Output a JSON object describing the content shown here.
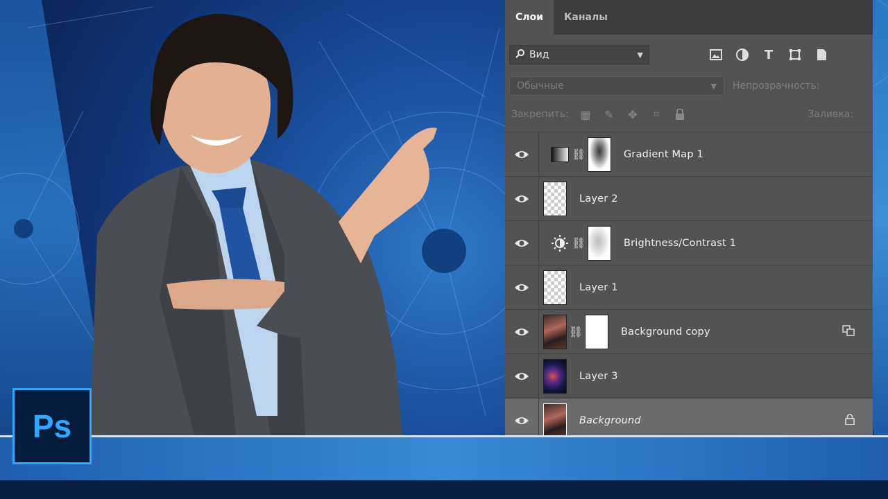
{
  "panel": {
    "tabs": [
      {
        "label": "Слои",
        "active": true
      },
      {
        "label": "Каналы",
        "active": false
      }
    ],
    "filter": {
      "label": "Вид"
    },
    "filter_icons": [
      "image-filter-icon",
      "adjustment-filter-icon",
      "type-filter-icon",
      "shape-filter-icon",
      "smart-object-filter-icon"
    ],
    "blend_mode": "Обычные",
    "opacity_label": "Непрозрачность:",
    "lock_label": "Закрепить:",
    "fill_label": "Заливка:",
    "layers": [
      {
        "name": "Gradient Map 1",
        "type": "adjustment",
        "icon": "gradient-map-icon",
        "has_mask": true
      },
      {
        "name": "Layer 2",
        "type": "pixel"
      },
      {
        "name": "Brightness/Contrast 1",
        "type": "adjustment",
        "icon": "brightness-contrast-icon",
        "has_mask": true
      },
      {
        "name": "Layer 1",
        "type": "pixel"
      },
      {
        "name": "Background copy",
        "type": "pixel-with-mask",
        "right_icon": "smart-object-icon"
      },
      {
        "name": "Layer 3",
        "type": "pixel"
      },
      {
        "name": "Background",
        "type": "background",
        "italic": true,
        "selected": true,
        "right_icon": "lock-icon"
      }
    ]
  },
  "logo": {
    "text": "Ps"
  },
  "colors": {
    "panel_bg": "#535353",
    "tab_bar": "#3c3c3c",
    "ps_blue": "#31a8ff",
    "ps_dark": "#061c3c"
  }
}
